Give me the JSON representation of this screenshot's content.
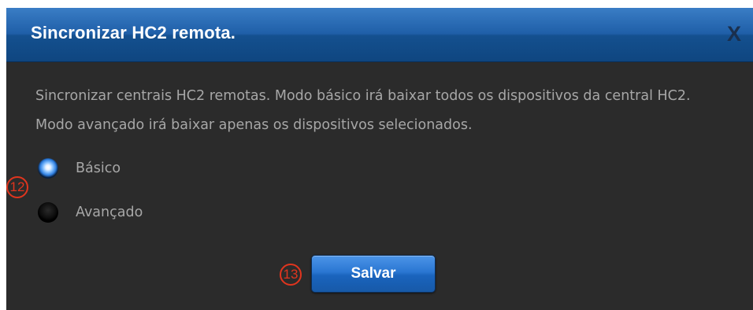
{
  "dialog": {
    "title": "Sincronizar HC2 remota.",
    "close_label": "X",
    "description": "Sincronizar centrais HC2 remotas. Modo básico irá baixar todos os dispositivos da central HC2. Modo avançado irá baixar apenas os dispositivos selecionados.",
    "options": [
      {
        "label": "Básico",
        "checked": true
      },
      {
        "label": "Avançado",
        "checked": false
      }
    ],
    "save_label": "Salvar"
  },
  "annotations": {
    "options_callout": "12",
    "save_callout": "13"
  },
  "colors": {
    "title_bar": "#1f5fa8",
    "dialog_bg": "#2b2b2b",
    "text": "#a7a7a7",
    "button": "#2a76d2",
    "callout": "#e0351e"
  }
}
